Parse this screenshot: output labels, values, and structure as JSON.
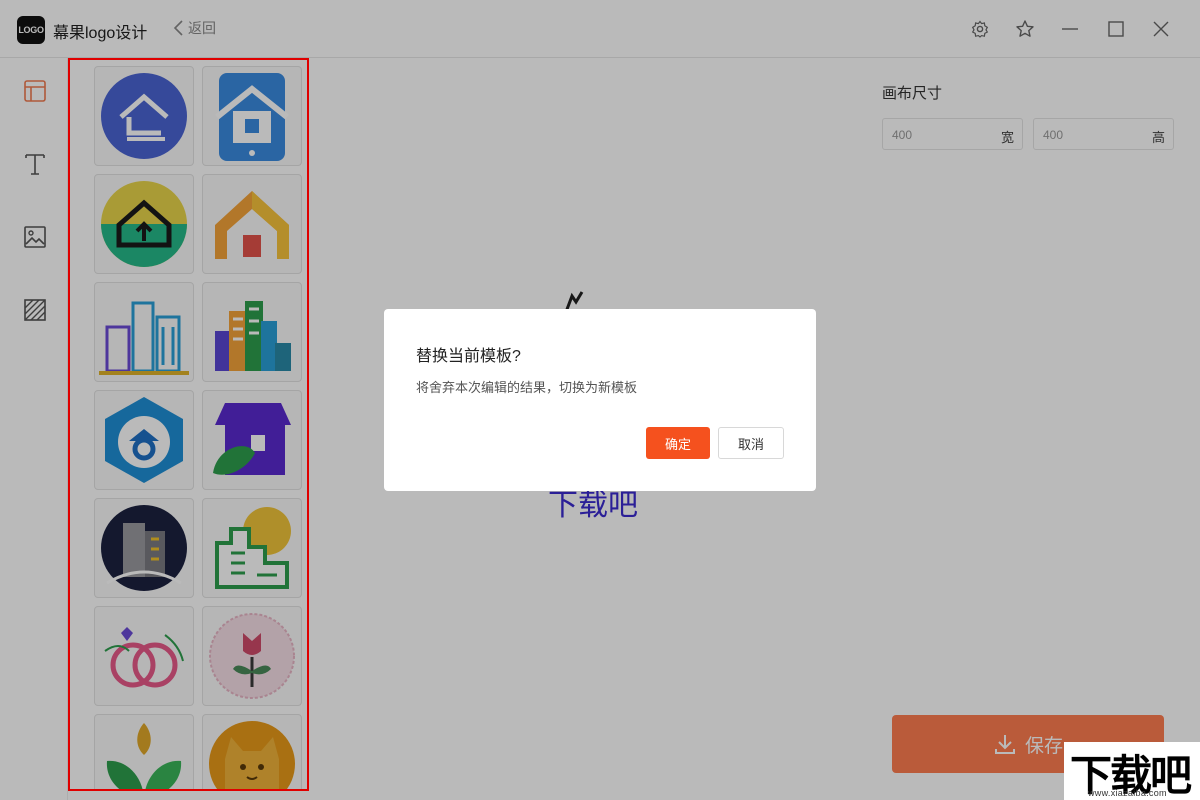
{
  "app": {
    "logo_text": "LOGO",
    "title": "幕果logo设计",
    "back_label": "返回"
  },
  "titlebar_icons": [
    "gear-icon",
    "star-icon",
    "minimize-icon",
    "maximize-icon",
    "close-icon"
  ],
  "tools": [
    "layout-icon",
    "text-icon",
    "image-icon",
    "background-icon"
  ],
  "templates": [
    "house-blue-circle",
    "house-phone-blue",
    "house-arrow-green",
    "house-gradient-orange",
    "city-buildings-blue",
    "city-buildings-color",
    "house-hexagon-blue",
    "shop-leaf-purple",
    "building-dark-circle",
    "building-green-sun",
    "wedding-rings",
    "rose-badge",
    "sprout-green",
    "cat-orange"
  ],
  "canvas": {
    "preview_text": "下载吧"
  },
  "properties": {
    "canvas_size_label": "画布尺寸",
    "width_value": "400",
    "width_unit": "宽",
    "height_value": "400",
    "height_unit": "高"
  },
  "save": {
    "label": "保存"
  },
  "dialog": {
    "title": "替换当前模板?",
    "message": "将舍弃本次编辑的结果，切换为新模板",
    "ok_label": "确定",
    "cancel_label": "取消"
  },
  "watermark": {
    "text": "下载吧",
    "url": "www.xiazaiba.com"
  },
  "colors": {
    "accent": "#f5511e",
    "save": "#ff7d50",
    "highlight_border": "#e00000"
  }
}
